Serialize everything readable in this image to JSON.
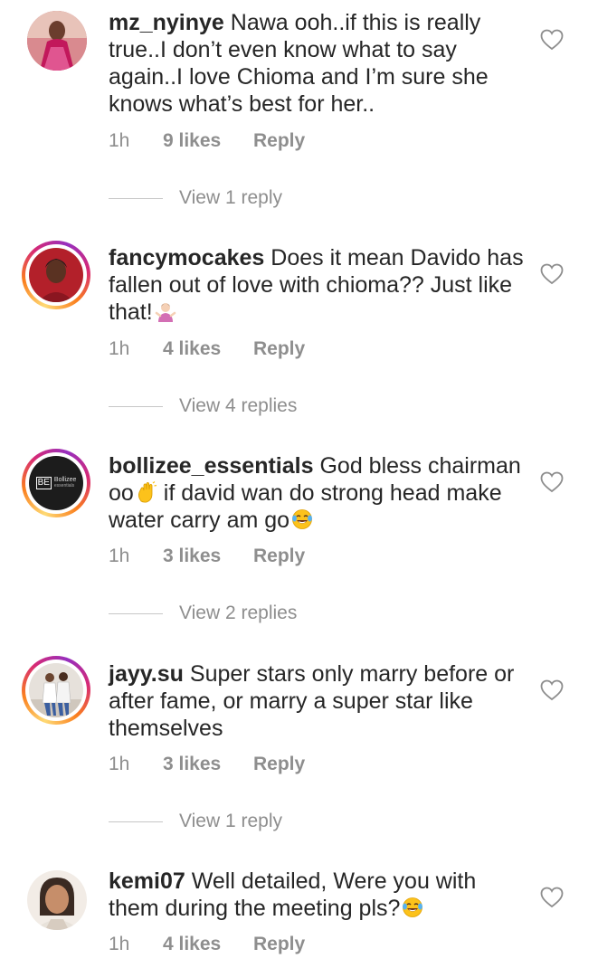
{
  "comments": [
    {
      "username": "mz_nyinye",
      "text": "Nawa ooh..if this is really true..I don’t even know what to say again..I love Chioma and I’m sure she knows what’s best for her..",
      "time": "1h",
      "likes": "9 likes",
      "reply_label": "Reply",
      "view_replies": "View 1 reply",
      "story_ring": false
    },
    {
      "username": "fancymocakes",
      "text": "Does it mean Davido has fallen out of love with chioma?? Just like that!",
      "emoji": "woman-shrugging",
      "time": "1h",
      "likes": "4 likes",
      "reply_label": "Reply",
      "view_replies": "View 4 replies",
      "story_ring": true
    },
    {
      "username": "bollizee_essentials",
      "text_before_emoji": "God bless chairman oo",
      "emoji_1": "waving-hand",
      "text_after_emoji": " if david wan do strong head make water carry am go",
      "emoji_2": "face-with-tears-of-joy",
      "avatar_logo": "BE",
      "avatar_brand": "Bollizee",
      "avatar_brand_sub": "essentials",
      "time": "1h",
      "likes": "3 likes",
      "reply_label": "Reply",
      "view_replies": "View 2 replies",
      "story_ring": true
    },
    {
      "username": "jayy.su",
      "text": "Super stars only marry before or after fame, or marry a super star like themselves",
      "time": "1h",
      "likes": "3 likes",
      "reply_label": "Reply",
      "view_replies": "View 1 reply",
      "story_ring": true
    },
    {
      "username": "kemi07",
      "text": "Well detailed, Were you with them during the meeting pls?",
      "emoji": "face-with-tears-of-joy",
      "time": "1h",
      "likes": "4 likes",
      "reply_label": "Reply",
      "story_ring": false
    }
  ],
  "colors": {
    "text": "#262626",
    "secondary": "#8e8e8e",
    "divider": "#c7c7c7",
    "story_ring": [
      "#feda75",
      "#fa7e1e",
      "#d62976",
      "#962fbf"
    ]
  },
  "icons": {
    "like": "heart-outline-icon"
  }
}
